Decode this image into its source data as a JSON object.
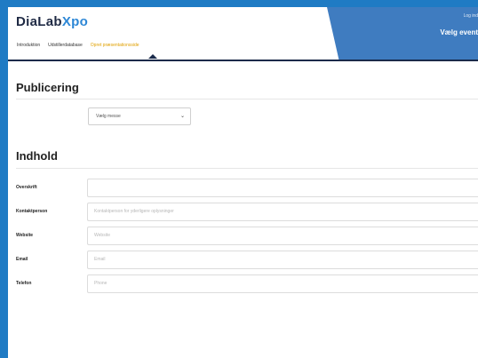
{
  "header": {
    "logo_main": "DiaLab",
    "logo_accent": "Xpo",
    "band_top": "Log ind",
    "band_title": "Vælg event"
  },
  "nav": {
    "items": [
      {
        "label": "Introduktion",
        "active": false
      },
      {
        "label": "Udstillerdatabase",
        "active": false
      },
      {
        "label": "Opret præsentationsside",
        "active": true
      }
    ]
  },
  "publicering": {
    "title": "Publicering",
    "select_value": "Vælg messe"
  },
  "indhold": {
    "title": "Indhold",
    "fields": [
      {
        "label": "Overskrift",
        "placeholder": ""
      },
      {
        "label": "Kontaktperson",
        "placeholder": "Kontaktperson for yderligere oplysninger"
      },
      {
        "label": "Website",
        "placeholder": "Website"
      },
      {
        "label": "Email",
        "placeholder": "Email"
      },
      {
        "label": "Telefon",
        "placeholder": "Phone"
      }
    ]
  },
  "colors": {
    "frame_bg": "#1f7bc4",
    "header_band": "#3f7cc0",
    "nav_active": "#e0a000"
  }
}
